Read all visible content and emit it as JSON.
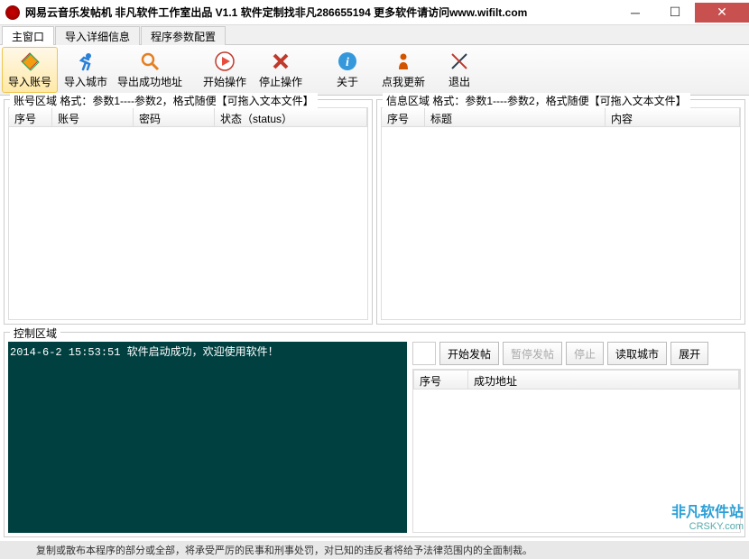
{
  "window": {
    "title": "网易云音乐发帖机 非凡软件工作室出品 V1.1  软件定制找非凡286655194 更多软件请访问www.wifilt.com"
  },
  "tabs": {
    "t1": "主窗口",
    "t2": "导入详细信息",
    "t3": "程序参数配置"
  },
  "toolbar": {
    "import_account": "导入账号",
    "import_city": "导入城市",
    "export_success": "导出成功地址",
    "start_op": "开始操作",
    "stop_op": "停止操作",
    "about": "关于",
    "click_update": "点我更新",
    "exit": "退出"
  },
  "panel_account": {
    "title": "账号区域  格式：参数1----参数2，格式随便【可拖入文本文件】",
    "col_index": "序号",
    "col_account": "账号",
    "col_password": "密码",
    "col_status": "状态（status）"
  },
  "panel_info": {
    "title": "信息区域  格式：参数1----参数2，格式随便【可拖入文本文件】",
    "col_index": "序号",
    "col_title": "标题",
    "col_content": "内容"
  },
  "control": {
    "title": "控制区域",
    "console_line": "2014-6-2 15:53:51   软件启动成功，欢迎使用软件！",
    "start_post": "开始发帖",
    "pause_post": "暂停发帖",
    "stop": "停止",
    "read_city": "读取城市",
    "expand": "展开",
    "res_index": "序号",
    "res_addr": "成功地址"
  },
  "footer": {
    "text": "复制或散布本程序的部分或全部，将承受严厉的民事和刑事处罚，对已知的违反者将给予法律范围内的全面制裁。"
  },
  "watermark": {
    "brand": "非凡软件站",
    "site": "CRSKY.com"
  }
}
